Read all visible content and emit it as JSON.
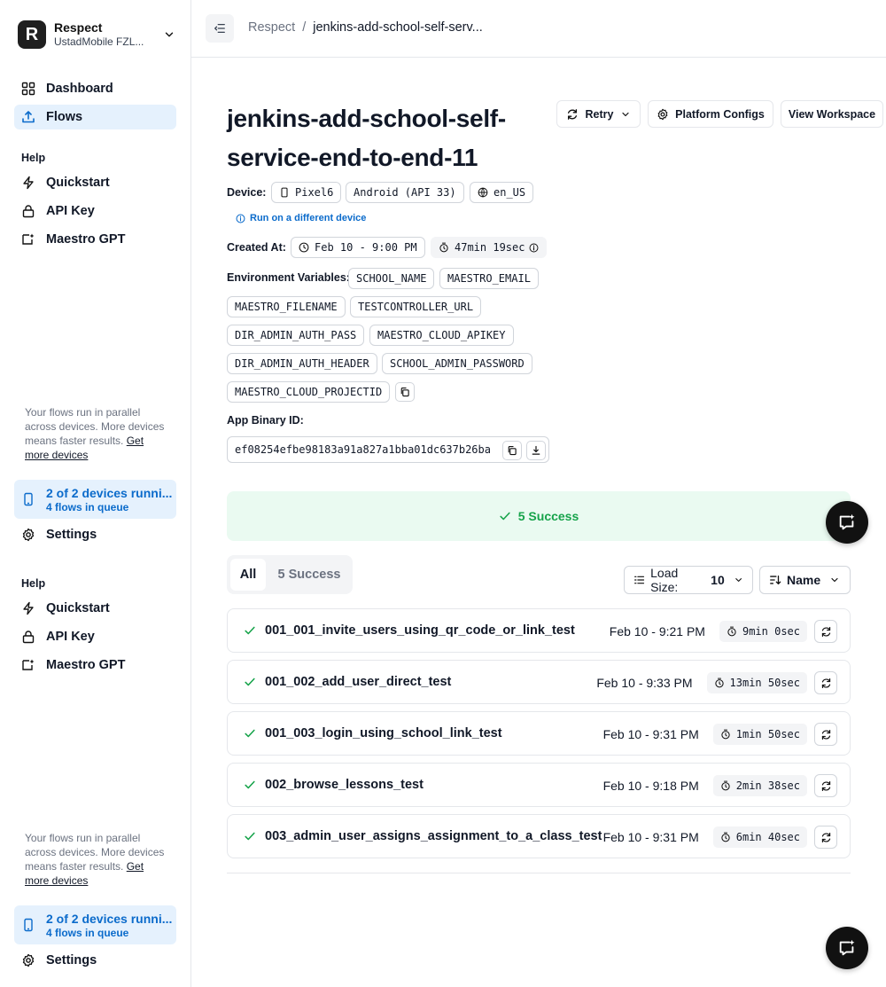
{
  "org": {
    "initial": "R",
    "name": "Respect",
    "subtitle": "UstadMobile FZL..."
  },
  "nav": {
    "dashboard": "Dashboard",
    "flows": "Flows",
    "help": "Help",
    "quickstart": "Quickstart",
    "api_key": "API Key",
    "maestro_gpt": "Maestro GPT",
    "promo_text": "Your flows run in parallel across devices. More devices means faster results.",
    "promo_link": "Get more devices",
    "devices_title": "2 of 2 devices runni...",
    "devices_sub": "4 flows in queue",
    "settings": "Settings"
  },
  "breadcrumb": {
    "parent": "Respect",
    "separator": "/",
    "current": "jenkins-add-school-self-serv..."
  },
  "upload": {
    "title": "jenkins-add-school-self-service-end-to-end-11",
    "retry_label": "Retry",
    "platform_configs_label": "Platform Configs",
    "view_workspace_label": "View Workspace",
    "device_label": "Device:",
    "device_name": "Pixel6",
    "device_os": "Android (API 33)",
    "device_locale": "en_US",
    "run_different": "Run on a different device",
    "created_label": "Created At:",
    "created_at": "Feb 10 - 9:00 PM",
    "duration": "47min 19sec",
    "env_label": "Environment Variables:",
    "env_vars": [
      "SCHOOL_NAME",
      "MAESTRO_EMAIL",
      "MAESTRO_FILENAME",
      "TESTCONTROLLER_URL",
      "DIR_ADMIN_AUTH_PASS",
      "MAESTRO_CLOUD_APIKEY",
      "DIR_ADMIN_AUTH_HEADER",
      "SCHOOL_ADMIN_PASSWORD",
      "MAESTRO_CLOUD_PROJECTID"
    ],
    "binary_label": "App Binary ID:",
    "binary_id": "ef08254efbe98183a91a827a1bba01dc637b26ba"
  },
  "summary": {
    "success_text": "5 Success",
    "success_color": "#16a34a"
  },
  "filters": {
    "tab_all": "All",
    "tab_success": "5 Success",
    "load_size_label": "Load Size:",
    "load_size_value": "10",
    "sort_label": "Name"
  },
  "flows": [
    {
      "name": "001_001_invite_users_using_qr_code_or_link_test",
      "date": "Feb 10 - 9:21 PM",
      "duration": "9min 0sec"
    },
    {
      "name": "001_002_add_user_direct_test",
      "date": "Feb 10 - 9:33 PM",
      "duration": "13min 50sec"
    },
    {
      "name": "001_003_login_using_school_link_test",
      "date": "Feb 10 - 9:31 PM",
      "duration": "1min 50sec"
    },
    {
      "name": "002_browse_lessons_test",
      "date": "Feb 10 - 9:18 PM",
      "duration": "2min 38sec"
    },
    {
      "name": "003_admin_user_assigns_assignment_to_a_class_test",
      "date": "Feb 10 - 9:31 PM",
      "duration": "6min 40sec"
    }
  ],
  "colors": {
    "accent": "#0b6bcb",
    "active_bg": "#e5f1fd",
    "success_bg": "#eafaf1",
    "fab": "#111111"
  },
  "icons": [
    "grid-icon",
    "upload-icon",
    "bolt-icon",
    "lock-icon",
    "sparkle-icon",
    "phone-icon",
    "gear-icon",
    "refresh-icon",
    "clock-icon",
    "timer-icon",
    "globe-icon",
    "info-icon",
    "copy-icon",
    "download-icon",
    "check-icon",
    "chat-icon"
  ]
}
